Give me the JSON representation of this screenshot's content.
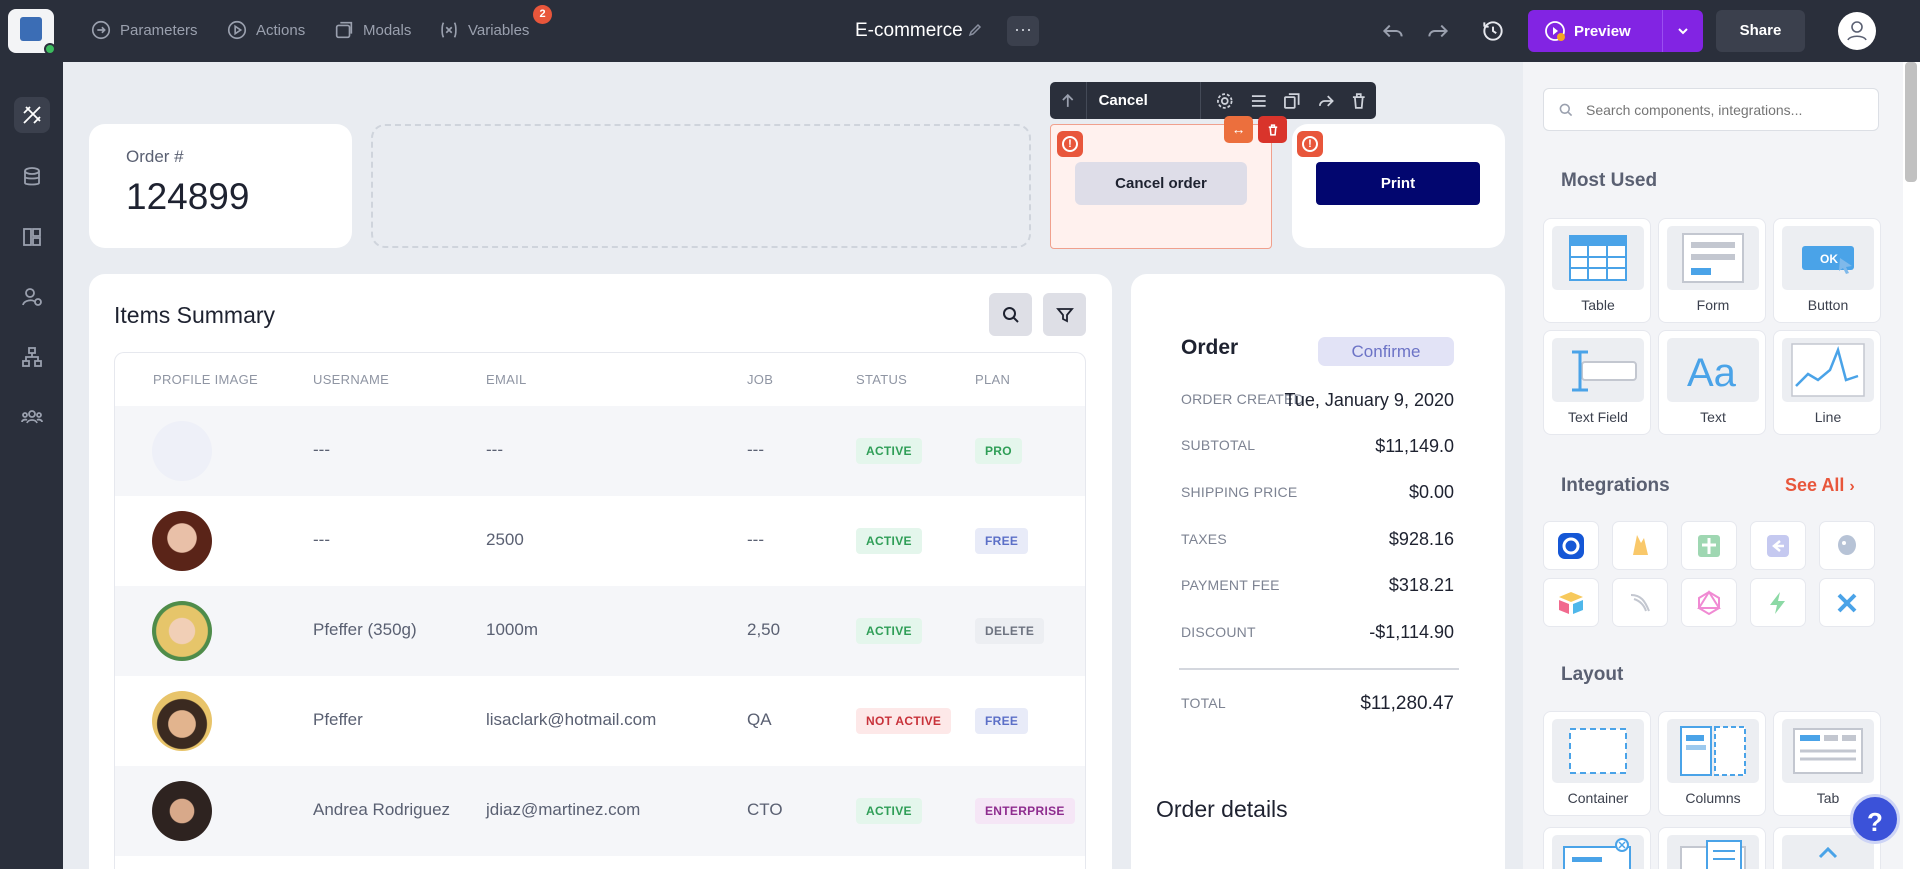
{
  "topbar": {
    "nav": [
      {
        "label": "Parameters",
        "icon": "parameters-icon"
      },
      {
        "label": "Actions",
        "icon": "play-circle-icon"
      },
      {
        "label": "Modals",
        "icon": "modals-icon"
      },
      {
        "label": "Variables",
        "icon": "variables-icon",
        "badge": "2"
      }
    ],
    "app_title": "E-commerce",
    "more": "···",
    "preview_label": "Preview",
    "share_label": "Share"
  },
  "canvas": {
    "order_number_label": "Order #",
    "order_number": "124899",
    "component_toolbar_label": "Cancel order",
    "cancel_button_label": "Cancel order",
    "print_button_label": "Print",
    "items_summary": {
      "title": "Items Summary",
      "columns": [
        "PROFILE IMAGE",
        "USERNAME",
        "EMAIL",
        "JOB",
        "STATUS",
        "PLAN"
      ],
      "rows": [
        {
          "username": "---",
          "email": "---",
          "job": "---",
          "status": "ACTIVE",
          "plan": "PRO"
        },
        {
          "username": "---",
          "email": "2500",
          "job": "---",
          "status": "ACTIVE",
          "plan": "FREE"
        },
        {
          "username": "Pfeffer (350g)",
          "email": "1000m",
          "job": "2,50",
          "status": "ACTIVE",
          "plan": "DELETE"
        },
        {
          "username": "Pfeffer",
          "email": "lisaclark@hotmail.com",
          "job": "QA",
          "status": "NOT ACTIVE",
          "plan": "FREE"
        },
        {
          "username": "Andrea Rodriguez",
          "email": "jdiaz@martinez.com",
          "job": "CTO",
          "status": "ACTIVE",
          "plan": "ENTERPRISE"
        }
      ]
    },
    "order": {
      "title": "Order",
      "status": "Confirme",
      "order_created_label": "ORDER CREATED",
      "order_created": "Tue, January 9, 2020",
      "subtotal_label": "SUBTOTAL",
      "subtotal": "$11,149.0",
      "shipping_label": "SHIPPING PRICE",
      "shipping": "$0.00",
      "taxes_label": "TAXES",
      "taxes": "$928.16",
      "payment_fee_label": "PAYMENT FEE",
      "payment_fee": "$318.21",
      "discount_label": "DISCOUNT",
      "discount": "-$1,114.90",
      "total_label": "TOTAL",
      "total": "$11,280.47",
      "details_title": "Order details"
    }
  },
  "panel": {
    "search_placeholder": "Search components, integrations...",
    "most_used_title": "Most Used",
    "most_used": [
      "Table",
      "Form",
      "Button",
      "Text Field",
      "Text",
      "Line"
    ],
    "integrations_title": "Integrations",
    "see_all": "See All",
    "layout_title": "Layout",
    "layout": [
      "Container",
      "Columns",
      "Tab"
    ],
    "help": "?"
  },
  "colors": {
    "accent": "#8224e3",
    "sidebar": "#2a2f3b",
    "print_button": "#02066f",
    "error": "#e8563b"
  }
}
